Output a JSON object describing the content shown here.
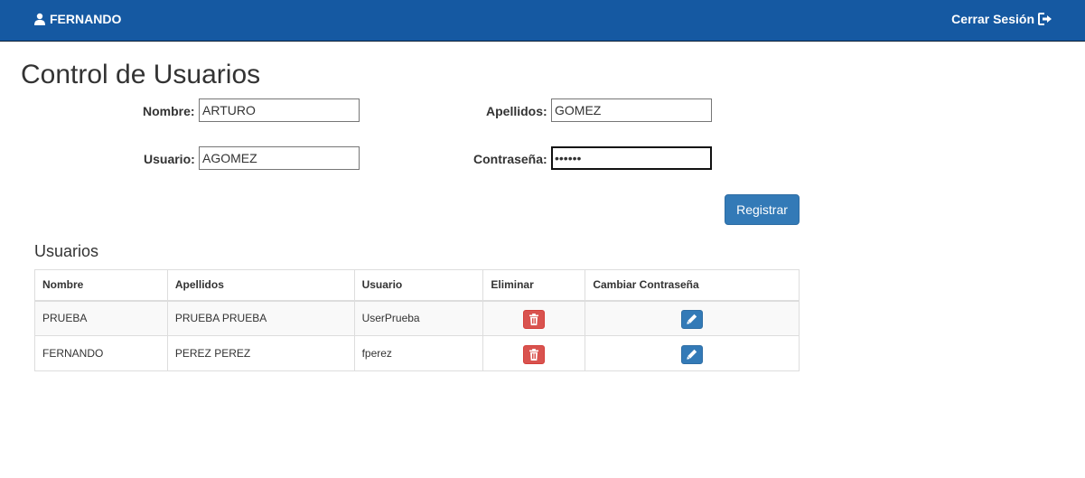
{
  "navbar": {
    "user_name": "FERNANDO",
    "logout_label": "Cerrar Sesión",
    "bg_color": "#1559a2"
  },
  "page": {
    "title": "Control de Usuarios"
  },
  "form": {
    "nombre": {
      "label": "Nombre:",
      "value": "ARTURO"
    },
    "apellidos": {
      "label": "Apellidos:",
      "value": "GOMEZ"
    },
    "usuario": {
      "label": "Usuario:",
      "value": "AGOMEZ"
    },
    "contrasena": {
      "label": "Contraseña:",
      "value": "••••••"
    },
    "submit_label": "Registrar"
  },
  "table": {
    "title": "Usuarios",
    "headers": {
      "nombre": "Nombre",
      "apellidos": "Apellidos",
      "usuario": "Usuario",
      "eliminar": "Eliminar",
      "cambiar": "Cambiar Contraseña"
    },
    "rows": [
      {
        "nombre": "PRUEBA",
        "apellidos": "PRUEBA PRUEBA",
        "usuario": "UserPrueba"
      },
      {
        "nombre": "FERNANDO",
        "apellidos": "PEREZ PEREZ",
        "usuario": "fperez"
      }
    ]
  },
  "icons": {
    "user": "user-icon",
    "logout": "logout-icon",
    "delete": "trash-icon",
    "edit": "pencil-icon"
  },
  "colors": {
    "primary": "#337ab7",
    "danger": "#d9534f"
  }
}
